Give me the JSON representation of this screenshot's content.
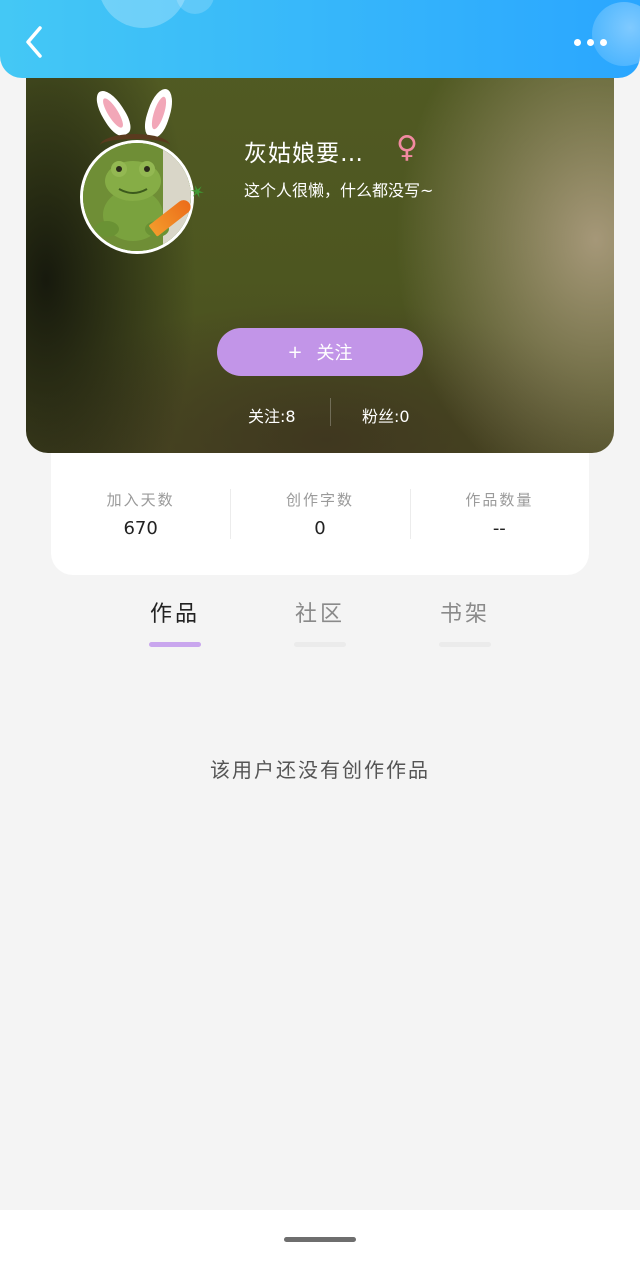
{
  "header_colors": {
    "topbar_start": "#44c8f5",
    "topbar_end": "#2aa6ff",
    "follow_button": "#c295e8",
    "tab_active_bar": "#c9a6ee"
  },
  "icons": {
    "back": "chevron-left-icon",
    "more": "more-dots-icon",
    "gender": "female-icon"
  },
  "profile": {
    "name": "灰姑娘要…",
    "gender_symbol": "♀",
    "bio": "这个人很懒，什么都没写~",
    "follow_button": {
      "plus": "+",
      "label": "关注"
    },
    "following": "关注:8",
    "fans": "粉丝:0"
  },
  "stats": [
    {
      "label": "加入天数",
      "value": "670"
    },
    {
      "label": "创作字数",
      "value": "0"
    },
    {
      "label": "作品数量",
      "value": "--"
    }
  ],
  "tabs": [
    {
      "label": "作品",
      "active": true
    },
    {
      "label": "社区",
      "active": false
    },
    {
      "label": "书架",
      "active": false
    }
  ],
  "empty_message": "该用户还没有创作作品"
}
